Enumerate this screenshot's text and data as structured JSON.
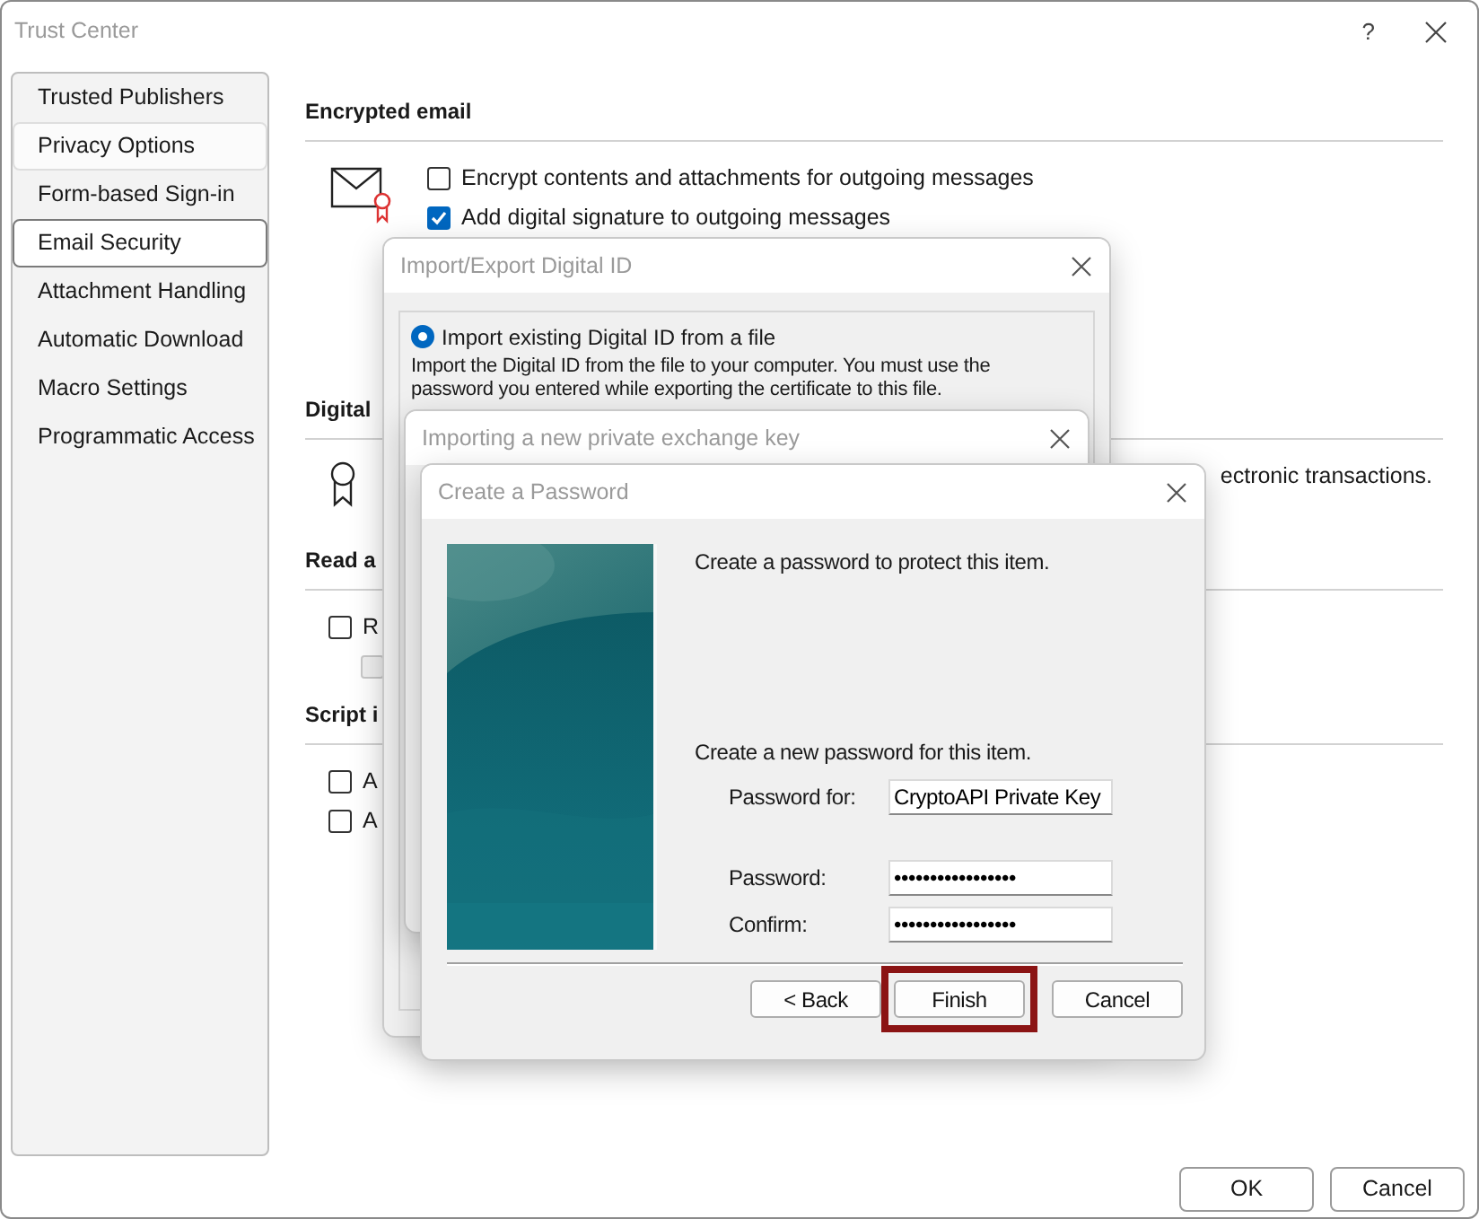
{
  "window": {
    "title": "Trust Center",
    "help": "?"
  },
  "sidebar": {
    "items": [
      {
        "label": "Trusted Publishers",
        "selected": false,
        "hovered": false
      },
      {
        "label": "Privacy Options",
        "selected": false,
        "hovered": true
      },
      {
        "label": "Form-based Sign-in",
        "selected": false,
        "hovered": false
      },
      {
        "label": "Email Security",
        "selected": true,
        "hovered": false
      },
      {
        "label": "Attachment Handling",
        "selected": false,
        "hovered": false
      },
      {
        "label": "Automatic Download",
        "selected": false,
        "hovered": false
      },
      {
        "label": "Macro Settings",
        "selected": false,
        "hovered": false
      },
      {
        "label": "Programmatic Access",
        "selected": false,
        "hovered": false
      }
    ]
  },
  "encrypted_email": {
    "heading": "Encrypted email",
    "options": [
      {
        "label": "Encrypt contents and attachments for outgoing messages",
        "checked": false
      },
      {
        "label": "Add digital signature to outgoing messages",
        "checked": true
      }
    ]
  },
  "section_2": {
    "heading": "Digital",
    "text": "ectronic transactions."
  },
  "section_3": {
    "heading": "Read a",
    "options": [
      {
        "label": "R",
        "checked": false,
        "disabled": false
      },
      {
        "checked": false,
        "disabled": true
      }
    ]
  },
  "section_4": {
    "heading": "Script i",
    "options": [
      {
        "label": "A",
        "checked": false,
        "disabled": false
      },
      {
        "label": "A",
        "checked": false,
        "disabled": false
      }
    ]
  },
  "footer_buttons": [
    "OK",
    "Cancel"
  ],
  "import_export_dialog": {
    "title": "Import/Export Digital ID",
    "option": {
      "label": "Import existing Digital ID from a file",
      "selected": true
    },
    "description": [
      "Import the Digital ID from the file to your computer. You must use the",
      "password you entered while exporting the certificate to this file."
    ]
  },
  "import_key_dialog": {
    "title": "Importing a new private exchange key"
  },
  "create_password_dialog": {
    "title": "Create a Password",
    "intro": "Create a password to protect this item.",
    "prompt": "Create a new password for this item.",
    "fields": [
      {
        "label": "Password for:",
        "value": "CryptoAPI Private Key"
      },
      {
        "label": "Password:",
        "value": "•••••••••••••••••"
      },
      {
        "label": "Confirm:",
        "value": "•••••••••••••••••"
      }
    ],
    "buttons": [
      {
        "label": "< Back",
        "highlighted": false
      },
      {
        "label": "Finish",
        "highlighted": true
      },
      {
        "label": "Cancel",
        "highlighted": false
      }
    ]
  }
}
